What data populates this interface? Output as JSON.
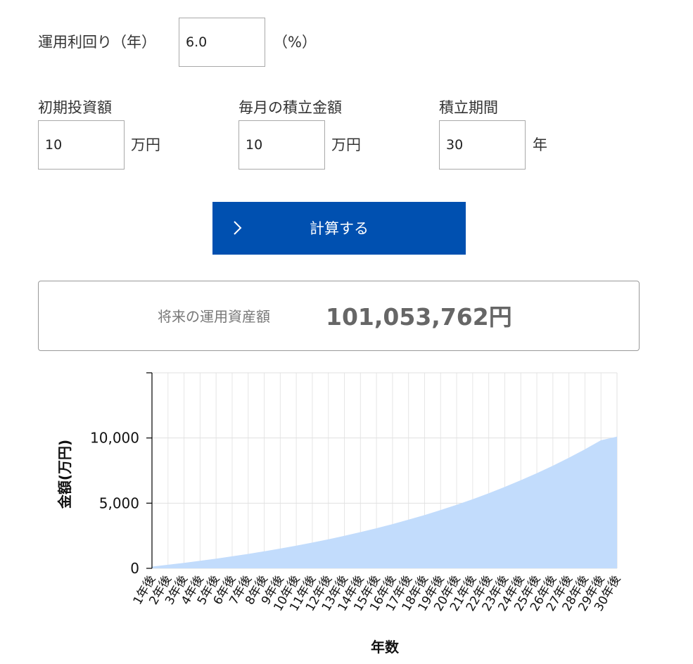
{
  "form": {
    "rate": {
      "label": "運用利回り（年）",
      "value": "6.0",
      "unit": "（%）"
    },
    "initial": {
      "label": "初期投資額",
      "value": "10",
      "unit": "万円"
    },
    "monthly": {
      "label": "毎月の積立金額",
      "value": "10",
      "unit": "万円"
    },
    "period": {
      "label": "積立期間",
      "value": "30",
      "unit": "年"
    }
  },
  "calc_button": {
    "label": "計算する",
    "icon": "chevron-right-icon",
    "color": "#0050b0"
  },
  "result": {
    "label": "将来の運用資産額",
    "value": "101,053,762円"
  },
  "chart_data": {
    "type": "area",
    "xlabel": "年数",
    "ylabel": "金額(万円)",
    "ylim": [
      0,
      15000
    ],
    "yticks": [
      0,
      5000,
      10000
    ],
    "ytick_labels": [
      "0",
      "5,000",
      "10,000"
    ],
    "grid": true,
    "color": "#c2dcfc",
    "categories": [
      "1年後",
      "2年後",
      "3年後",
      "4年後",
      "5年後",
      "6年後",
      "7年後",
      "8年後",
      "9年後",
      "10年後",
      "11年後",
      "12年後",
      "13年後",
      "14年後",
      "15年後",
      "16年後",
      "17年後",
      "18年後",
      "19年後",
      "20年後",
      "21年後",
      "22年後",
      "23年後",
      "24年後",
      "25年後",
      "26年後",
      "27年後",
      "28年後",
      "29年後",
      "30年後"
    ],
    "values": [
      135,
      274,
      422,
      579,
      745,
      921,
      1108,
      1307,
      1517,
      1741,
      1977,
      2229,
      2495,
      2778,
      3078,
      3396,
      3734,
      4092,
      4473,
      4876,
      5305,
      5759,
      6241,
      6753,
      7297,
      7874,
      8486,
      9136,
      9826,
      10105
    ]
  }
}
